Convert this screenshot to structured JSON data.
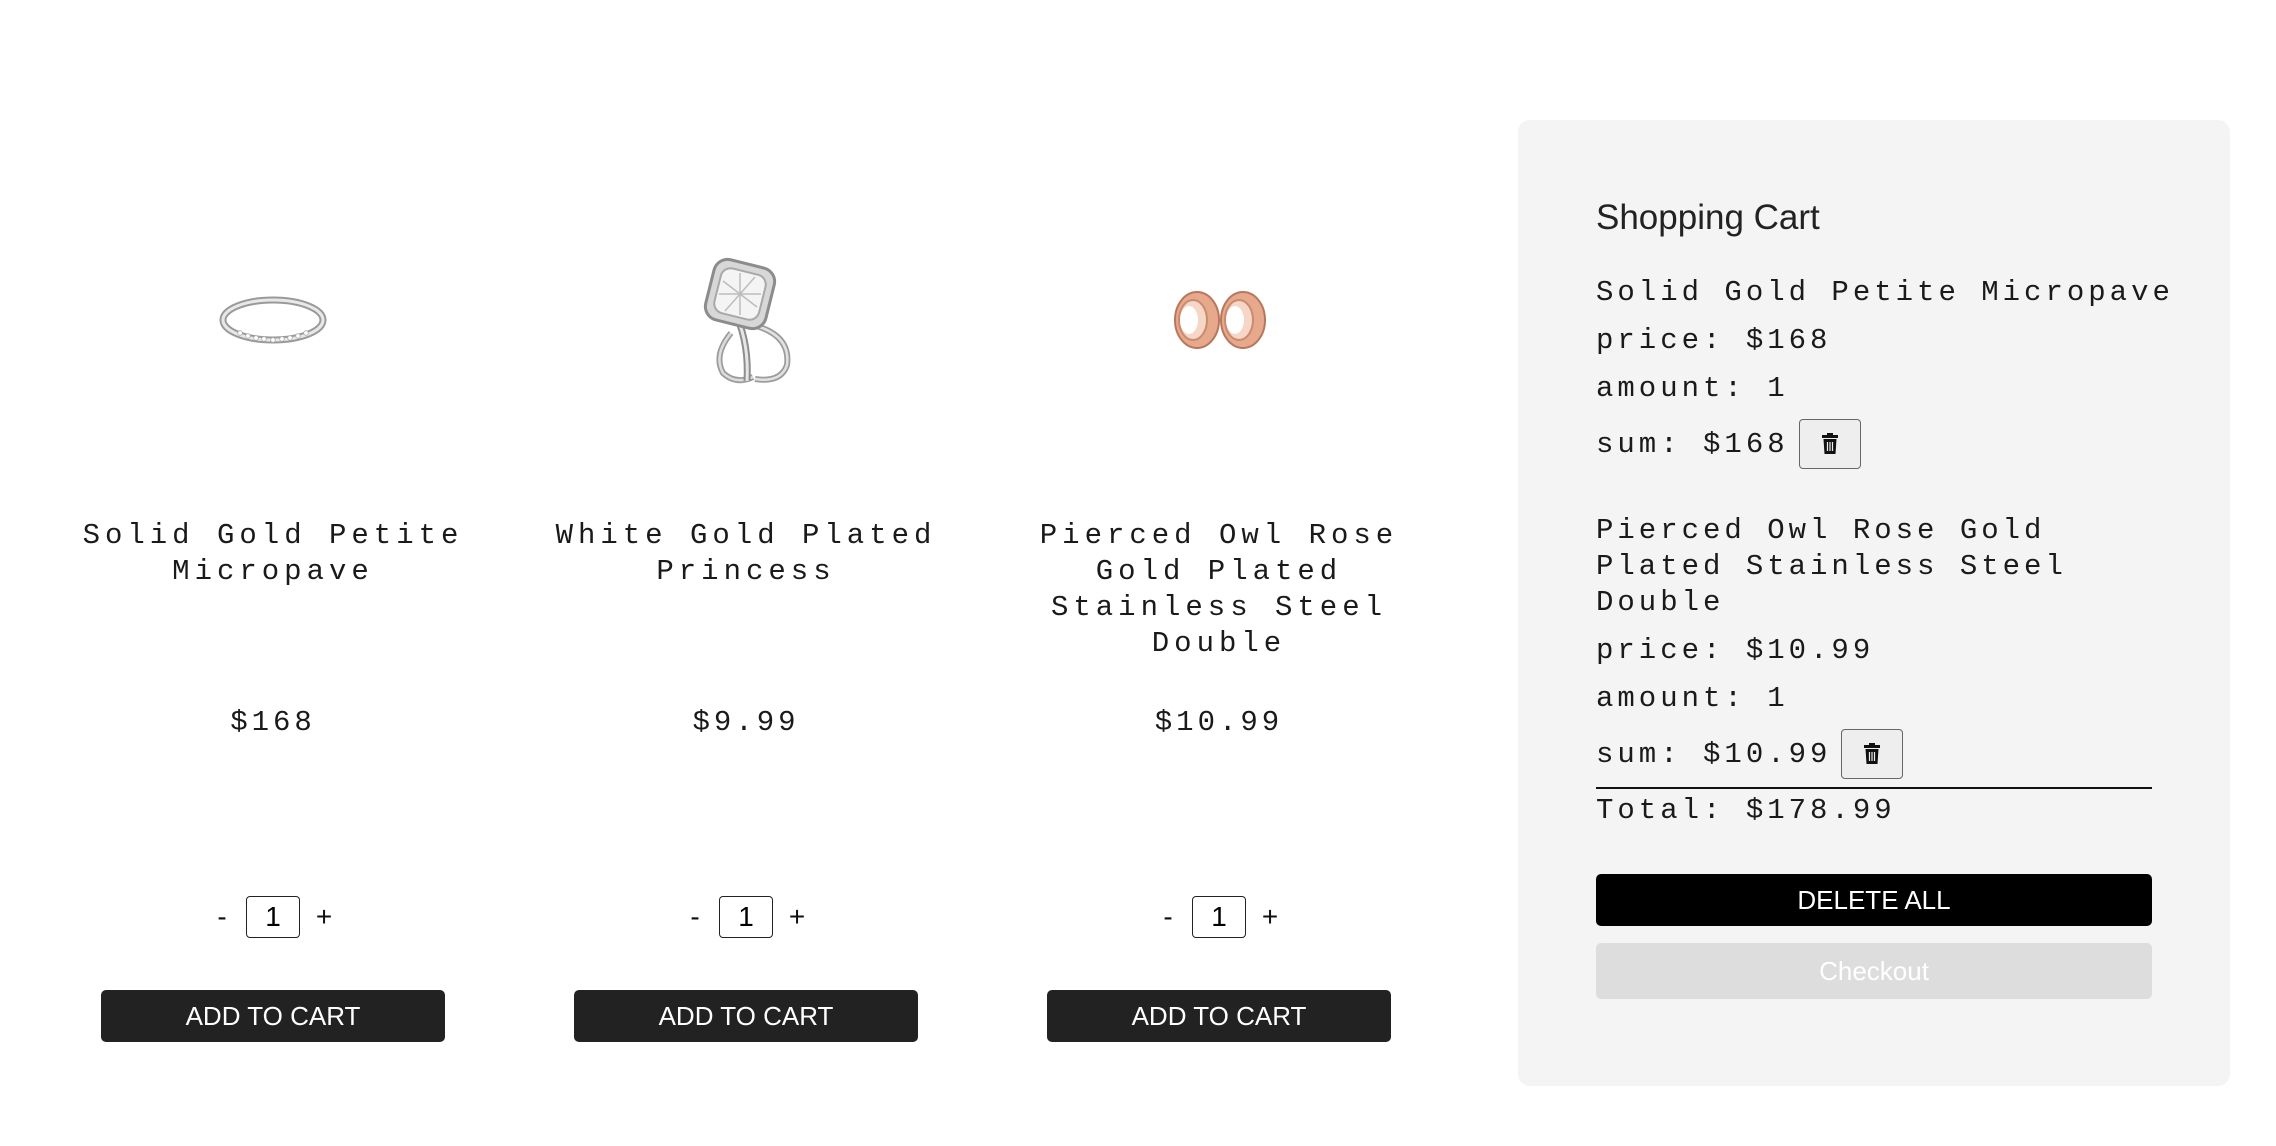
{
  "products": [
    {
      "name": "Solid Gold Petite Micropave",
      "price": "$168",
      "quantity": "1",
      "image": "ring-icon",
      "add_label": "ADD TO CART"
    },
    {
      "name": "White Gold Plated Princess",
      "price": "$9.99",
      "quantity": "1",
      "image": "engagement-ring-icon",
      "add_label": "ADD TO CART"
    },
    {
      "name": "Pierced Owl Rose Gold Plated Stainless Steel Double",
      "price": "$10.99",
      "quantity": "1",
      "image": "ear-tunnels-icon",
      "add_label": "ADD TO CART"
    }
  ],
  "stepper": {
    "minus": "-",
    "plus": "+"
  },
  "cart": {
    "title": "Shopping Cart",
    "items": [
      {
        "name": "Solid Gold Petite Micropave",
        "price": "price: $168",
        "amount": "amount: 1",
        "sum": "sum: $168"
      },
      {
        "name": "Pierced Owl Rose Gold Plated Stainless Steel Double",
        "price": "price: $10.99",
        "amount": "amount: 1",
        "sum": "sum: $10.99"
      }
    ],
    "total": "Total: $178.99",
    "delete_all_label": "DELETE ALL",
    "checkout_label": "Checkout"
  },
  "colors": {
    "button_dark": "#222222",
    "delete_all_bg": "#000000",
    "checkout_disabled": "#dddddd",
    "cart_bg": "#f4f4f4",
    "rose_gold": "#d9967a"
  }
}
